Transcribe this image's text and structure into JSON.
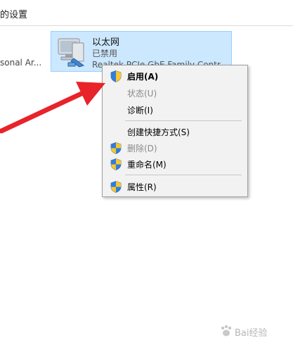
{
  "window": {
    "title": "的设置"
  },
  "adapters": {
    "left_partial_label": "sonal Ar...",
    "selected": {
      "name": "以太网",
      "status": "已禁用",
      "device": "Realtek PCIe GbE Family Contr..."
    }
  },
  "context_menu": {
    "items": [
      {
        "label": "启用(A)",
        "shield": true,
        "disabled": false,
        "bold": true
      },
      {
        "label": "状态(U)",
        "shield": false,
        "disabled": true,
        "bold": false
      },
      {
        "label": "诊断(I)",
        "shield": false,
        "disabled": false,
        "bold": false
      },
      {
        "label": "创建快捷方式(S)",
        "shield": false,
        "disabled": false,
        "bold": false
      },
      {
        "label": "删除(D)",
        "shield": true,
        "disabled": true,
        "bold": false
      },
      {
        "label": "重命名(M)",
        "shield": true,
        "disabled": false,
        "bold": false
      },
      {
        "label": "属性(R)",
        "shield": true,
        "disabled": false,
        "bold": false
      }
    ]
  },
  "annotation": {
    "arrow_color": "#e8232a",
    "target": "启用(A)"
  },
  "watermark": {
    "text": "Bai经验"
  },
  "colors": {
    "selection_bg": "#cce8ff",
    "selection_border": "#99d1ff",
    "menu_bg": "#f2f2f2"
  }
}
